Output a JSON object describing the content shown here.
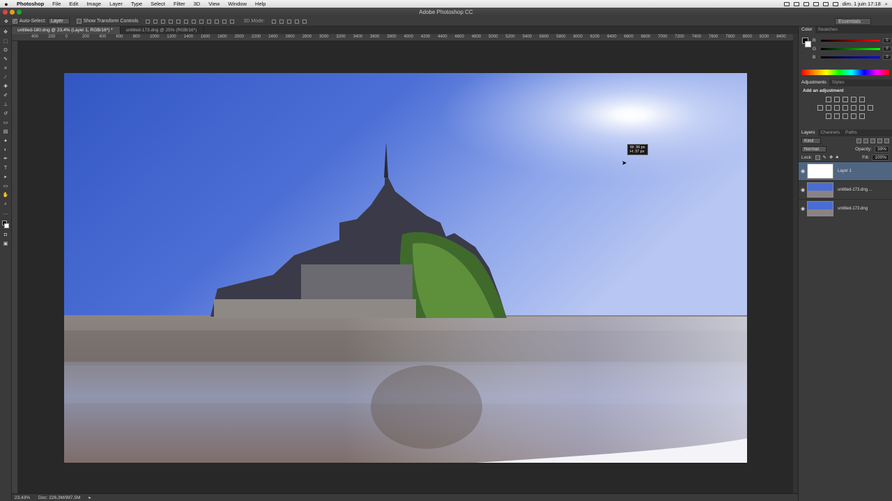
{
  "menubar": {
    "apple": "",
    "items": [
      "Photoshop",
      "File",
      "Edit",
      "Image",
      "Layer",
      "Type",
      "Select",
      "Filter",
      "3D",
      "View",
      "Window",
      "Help"
    ],
    "clock": "dim. 1 juin  17:18"
  },
  "window": {
    "title": "Adobe Photoshop CC"
  },
  "options": {
    "auto_select_label": "Auto-Select:",
    "auto_select_value": "Layer",
    "show_transform_label": "Show Transform Controls",
    "mode_3d": "3D Mode:",
    "workspace": "Essentials"
  },
  "tabs": [
    {
      "label": "untitled-180.dng @ 23,4% (Layer 1, RGB/16*) *",
      "active": true
    },
    {
      "label": "untitled-173.dng @ 25% (RGB/16*)",
      "active": false
    }
  ],
  "ruler": [
    "400",
    "200",
    "0",
    "200",
    "400",
    "600",
    "800",
    "1000",
    "1200",
    "1400",
    "1600",
    "1800",
    "2000",
    "2200",
    "2400",
    "2600",
    "2800",
    "3000",
    "3200",
    "3400",
    "3600",
    "3800",
    "4000",
    "4200",
    "4400",
    "4600",
    "4800",
    "5000",
    "5200",
    "5400",
    "5600",
    "5800",
    "6000",
    "6200",
    "6400",
    "6600",
    "6800",
    "7000",
    "7200",
    "7400",
    "7600",
    "7800",
    "8000",
    "8200",
    "8400",
    "8600",
    "8800"
  ],
  "canvas": {
    "tooltip_w": "W: 36 px",
    "tooltip_h": "H: 37 px"
  },
  "status": {
    "zoom": "23,43%",
    "doc": "Doc: 226,3M/987,5M"
  },
  "color_panel": {
    "tabs": [
      "Color",
      "Swatches"
    ],
    "rows": [
      {
        "label": "R",
        "value": "0"
      },
      {
        "label": "G",
        "value": "0"
      },
      {
        "label": "B",
        "value": "0"
      }
    ]
  },
  "adjustments_panel": {
    "tabs": [
      "Adjustments",
      "Styles"
    ],
    "title": "Add an adjustment"
  },
  "layers_panel": {
    "tabs": [
      "Layers",
      "Channels",
      "Paths"
    ],
    "kind": "Kind",
    "blend_mode": "Normal",
    "opacity_label": "Opacity:",
    "opacity_value": "39%",
    "lock_label": "Lock:",
    "fill_label": "Fill:",
    "fill_value": "100%",
    "layers": [
      {
        "name": "Layer 1",
        "selected": true
      },
      {
        "name": "untitled-173.dng ...",
        "selected": false
      },
      {
        "name": "untitled-173.dng",
        "selected": false
      }
    ]
  },
  "colors": {
    "accent": "#506580",
    "sky": "#4a6dd3",
    "sand": "#8a7a70"
  }
}
